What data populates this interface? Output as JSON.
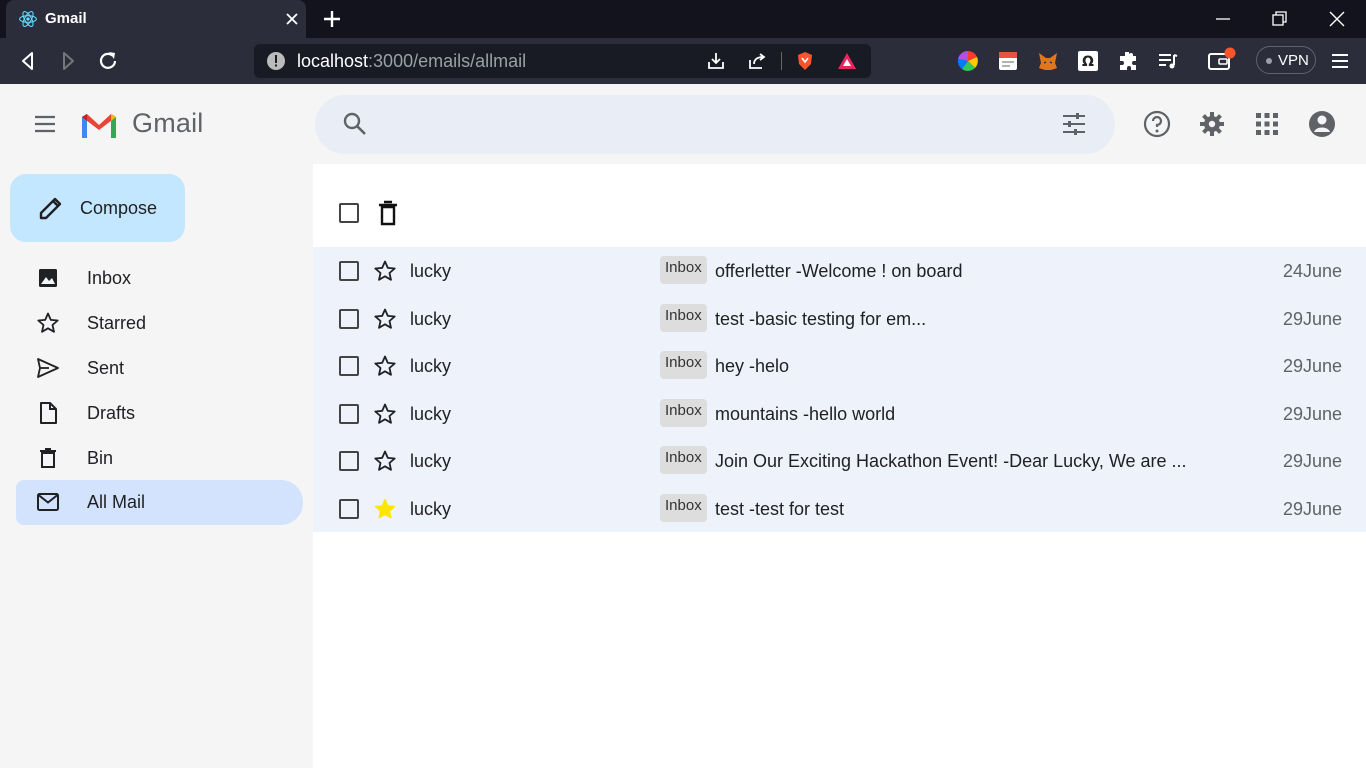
{
  "browser": {
    "tab_title": "Gmail",
    "url_host": "localhost",
    "url_path": ":3000/emails/allmail",
    "vpn_label": "VPN"
  },
  "app": {
    "brand": "Gmail",
    "search_placeholder": ""
  },
  "compose": {
    "label": "Compose"
  },
  "sidebar": {
    "items": [
      {
        "label": "Inbox",
        "icon": "photo-icon",
        "active": false
      },
      {
        "label": "Starred",
        "icon": "star-outline-icon",
        "active": false
      },
      {
        "label": "Sent",
        "icon": "send-icon",
        "active": false
      },
      {
        "label": "Drafts",
        "icon": "file-icon",
        "active": false
      },
      {
        "label": "Bin",
        "icon": "trash-icon",
        "active": false
      },
      {
        "label": "All Mail",
        "icon": "mail-icon",
        "active": true
      }
    ]
  },
  "emails": [
    {
      "sender": "lucky",
      "label": "Inbox",
      "subject": "offerletter -Welcome ! on board",
      "date": "24June",
      "starred": false
    },
    {
      "sender": "lucky",
      "label": "Inbox",
      "subject": "test -basic testing for em...",
      "date": "29June",
      "starred": false
    },
    {
      "sender": "lucky",
      "label": "Inbox",
      "subject": "hey -helo",
      "date": "29June",
      "starred": false
    },
    {
      "sender": "lucky",
      "label": "Inbox",
      "subject": "mountains -hello world",
      "date": "29June",
      "starred": false
    },
    {
      "sender": "lucky",
      "label": "Inbox",
      "subject": "Join Our Exciting Hackathon Event! -Dear Lucky, We are ...",
      "date": "29June",
      "starred": false
    },
    {
      "sender": "lucky",
      "label": "Inbox",
      "subject": "test -test for test",
      "date": "29June",
      "starred": true
    }
  ],
  "colors": {
    "compose_bg": "#c2e7ff",
    "active_nav_bg": "#d3e3fd",
    "row_bg": "#eef2fb",
    "star_fill": "#ffe600"
  }
}
